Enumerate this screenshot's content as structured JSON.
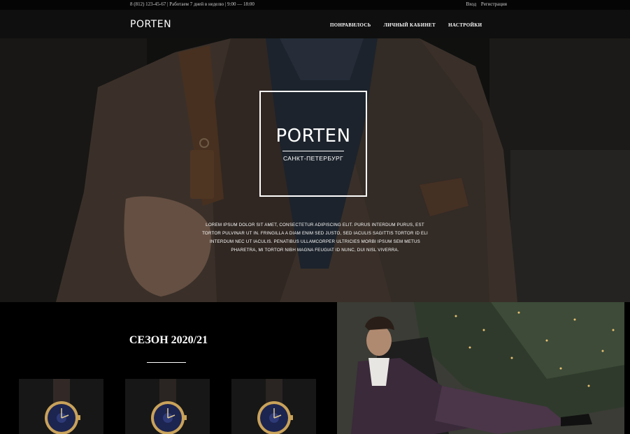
{
  "topbar": {
    "info": "8 (812) 123-45-67 | Работаем 7 дней в неделю | 9:00 — 18:00",
    "login": "Вход",
    "register": "Регистрация"
  },
  "nav": {
    "logo": "PORTEN",
    "items": [
      {
        "label": "ПОНРАВИЛОСЬ"
      },
      {
        "label": "ЛИЧНЫЙ КАБИНЕТ"
      },
      {
        "label": "НАСТРОЙКИ"
      }
    ]
  },
  "hero": {
    "title": "PORTEN",
    "city": "САНКТ-ПЕТЕРБУРГ",
    "text": "LOREM IPSUM DOLOR SIT AMET, CONSECTETUR ADIPISCING ELIT. PURUS INTERDUM PURUS, EST TORTOR PULVINAR UT IN. FRINGILLA A DIAM ENIM SED JUSTO, SED IACULIS SAGITTIS TORTOR ID ELI INTERDUM NEC UT IACULIS. PENATIBUS ULLAMCORPER ULTRICIES MORBI IPSUM SEM METUS PHARETRA, MI TORTOR NIBH MAGNA FEUGIAT ID NUNC, DUI NISL VIVERRA."
  },
  "season": {
    "title": "СЕЗОН 2020/21",
    "products": [
      {
        "icon": "watch-icon"
      },
      {
        "icon": "watch-icon"
      },
      {
        "icon": "watch-icon"
      }
    ]
  },
  "colors": {
    "background": "#000000",
    "nav": "#0f0f0f",
    "card": "#171717",
    "text": "#ffffff"
  }
}
